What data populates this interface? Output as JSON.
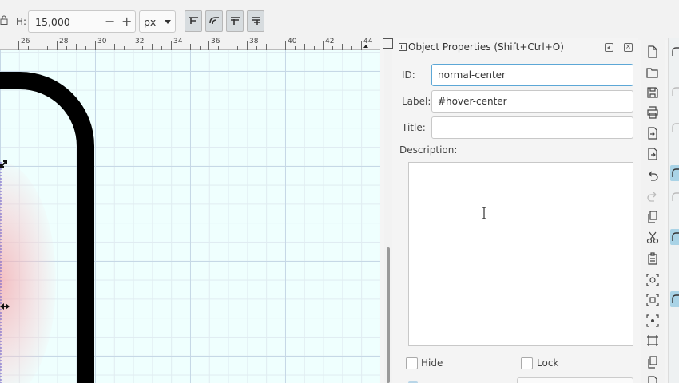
{
  "toolbar": {
    "h_label": "H:",
    "h_value": "15,000",
    "minus": "−",
    "plus": "+",
    "unit": "px",
    "buttons": [
      "align-top-edge-icon",
      "align-round-corner-icon",
      "align-middle-icon",
      "align-bottom-edge-icon"
    ]
  },
  "ruler": {
    "ticks": [
      "26",
      "28",
      "30",
      "32",
      "34",
      "36",
      "38",
      "40",
      "42",
      "44"
    ]
  },
  "dock": {
    "title": "Object Properties (Shift+Ctrl+O)",
    "id_label": "ID:",
    "id_value": "normal-center",
    "label_label": "Label:",
    "label_value": "#hover-center",
    "title_label": "Title:",
    "title_value": "",
    "description_label": "Description:",
    "description_value": "",
    "hide_label": "Hide",
    "lock_label": "Lock"
  },
  "commandbar": {
    "icons": [
      "new-document-icon",
      "open-folder-icon",
      "save-icon",
      "print-icon",
      "import-icon",
      "export-icon",
      "undo-icon",
      "redo-icon",
      "copy-icon",
      "cut-icon",
      "paste-icon",
      "zoom-selection-icon",
      "zoom-drawing-icon",
      "zoom-page-icon",
      "resize-page-icon",
      "duplicate-icon",
      "clone-icon"
    ]
  },
  "colors": {
    "canvas_bg": "#effffe",
    "grid_major": "#c6d8e6",
    "focus_border": "#5ca7d6",
    "snap_active": "#a9d3e6",
    "shape_stroke": "#000000"
  }
}
